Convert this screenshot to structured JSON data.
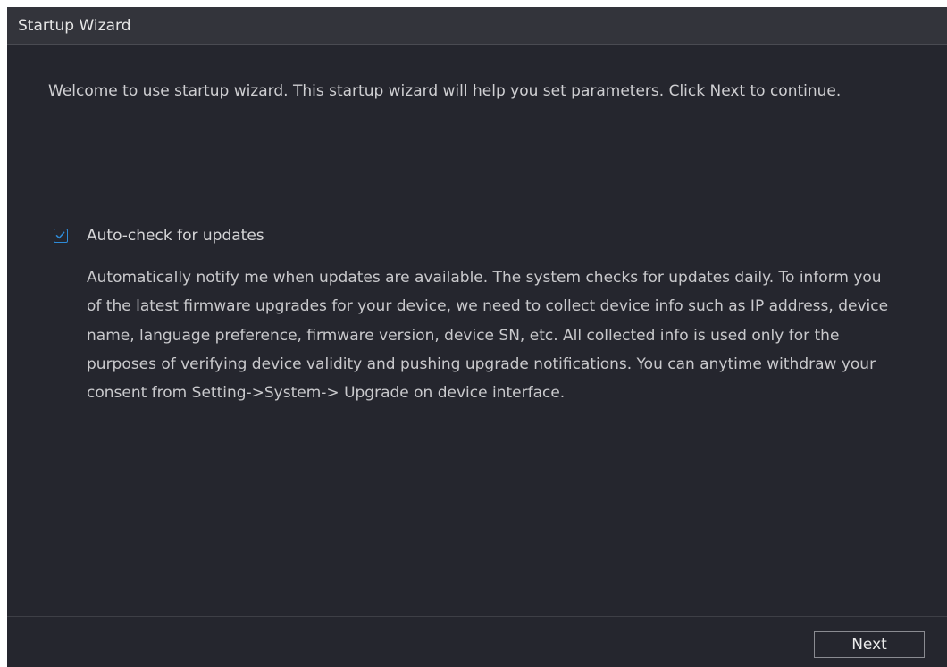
{
  "window": {
    "title": "Startup Wizard"
  },
  "intro": {
    "text": "Welcome to use startup wizard. This startup wizard will help you set parameters. Click Next to continue."
  },
  "auto_update": {
    "checked": true,
    "label": "Auto-check for updates",
    "description": "Automatically notify me when updates are available. The system checks for updates daily. To inform you of the latest firmware upgrades for your device, we need to collect device info such as IP address, device name, language preference, firmware version, device SN, etc. All collected info is used only for the purposes of verifying device validity and pushing upgrade notifications. You can anytime withdraw your consent from Setting->System-> Upgrade on device interface."
  },
  "footer": {
    "next_label": "Next"
  },
  "colors": {
    "background": "#25262e",
    "titlebar": "#33343b",
    "accent": "#2e8bd8"
  },
  "icons": {
    "checkbox": "checkmark-icon"
  }
}
